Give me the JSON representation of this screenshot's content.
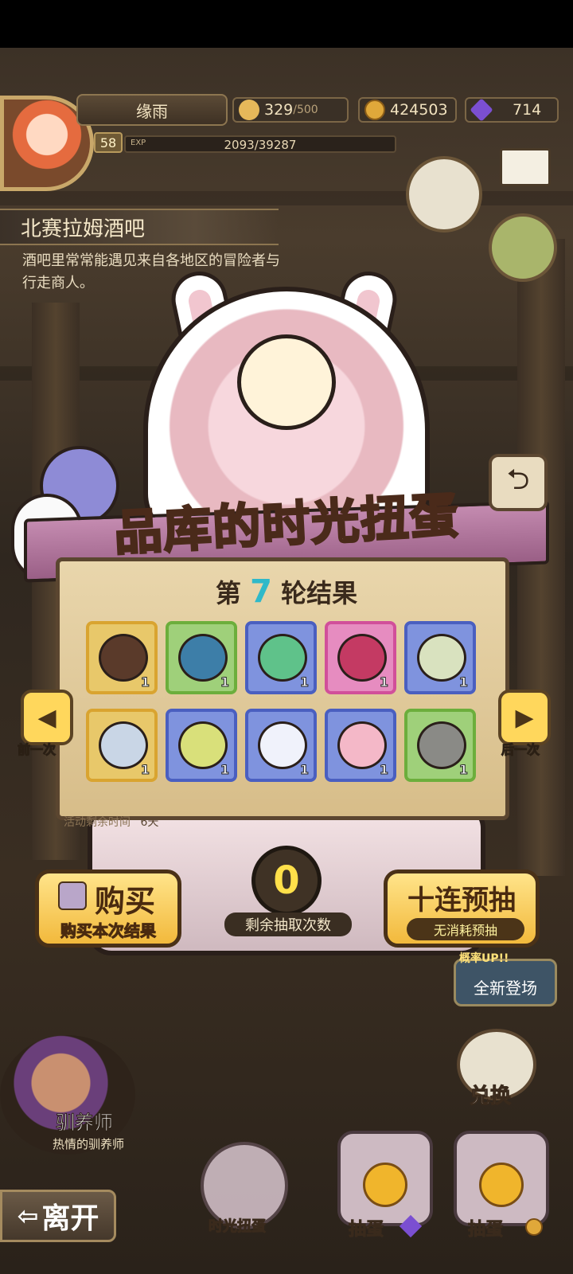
{
  "player": {
    "name": "缘雨",
    "level": "58",
    "exp_label": "EXP",
    "exp_value": "2093/39287",
    "stamina": "329",
    "stamina_max": "/500",
    "gold": "424503",
    "gems": "714"
  },
  "location": {
    "title": "北赛拉姆酒吧",
    "description": "酒吧里常常能遇见来自各地区的冒险者与行走商人。"
  },
  "event": {
    "banner_title": "品库的时光扭蛋",
    "round_prefix": "第",
    "round_number": "7",
    "round_suffix": "轮结果",
    "time_left_label": "活动剩余时间",
    "time_left_value": "6天",
    "prev_label": "前一次",
    "next_label": "后一次",
    "remaining_count": "0",
    "remaining_label": "剩余抽取次数",
    "buy_title": "购买",
    "buy_sub": "购买本次结果",
    "preview_title": "十连预抽",
    "preview_sub": "无消耗预抽",
    "new_badge": "全新登场",
    "rate_up": "概率UP!!"
  },
  "results": [
    {
      "name": "horned-gear",
      "qty": "1",
      "border": "#d9a430",
      "bg": "#e8c86a",
      "item": "#5a3a2a"
    },
    {
      "name": "spiral-shell",
      "qty": "1",
      "border": "#6cae3c",
      "bg": "#9fd07a",
      "item": "#3d7ea8"
    },
    {
      "name": "green-armor",
      "qty": "1",
      "border": "#4a5fc0",
      "bg": "#7f93de",
      "item": "#5fc28a"
    },
    {
      "name": "rose-helmet",
      "qty": "1",
      "border": "#d14f9a",
      "bg": "#e68cc0",
      "item": "#c43a63"
    },
    {
      "name": "leaf-pendant",
      "qty": "1",
      "border": "#4a5fc0",
      "bg": "#7f93de",
      "item": "#d9e2bf"
    },
    {
      "name": "pocket-watch",
      "qty": "1",
      "border": "#d9a430",
      "bg": "#e8c86a",
      "item": "#c9d6e6"
    },
    {
      "name": "spotted-egg",
      "qty": "1",
      "border": "#4a5fc0",
      "bg": "#7f93de",
      "item": "#d9e07a"
    },
    {
      "name": "bow-egg",
      "qty": "1",
      "border": "#4a5fc0",
      "bg": "#7f93de",
      "item": "#f0f2fb"
    },
    {
      "name": "pink-scarf",
      "qty": "1",
      "border": "#4a5fc0",
      "bg": "#7f93de",
      "item": "#f4b8c8"
    },
    {
      "name": "gray-hair",
      "qty": "1",
      "border": "#6cae3c",
      "bg": "#9fd07a",
      "item": "#8a8a86"
    }
  ],
  "npc": {
    "name": "驯养师",
    "subtitle": "热情的驯养师"
  },
  "bottom": {
    "leave": "离开",
    "time_gacha": "时光扭蛋",
    "egg_gem": "抽蛋",
    "egg_gold": "抽蛋",
    "exchange": "兑换"
  }
}
